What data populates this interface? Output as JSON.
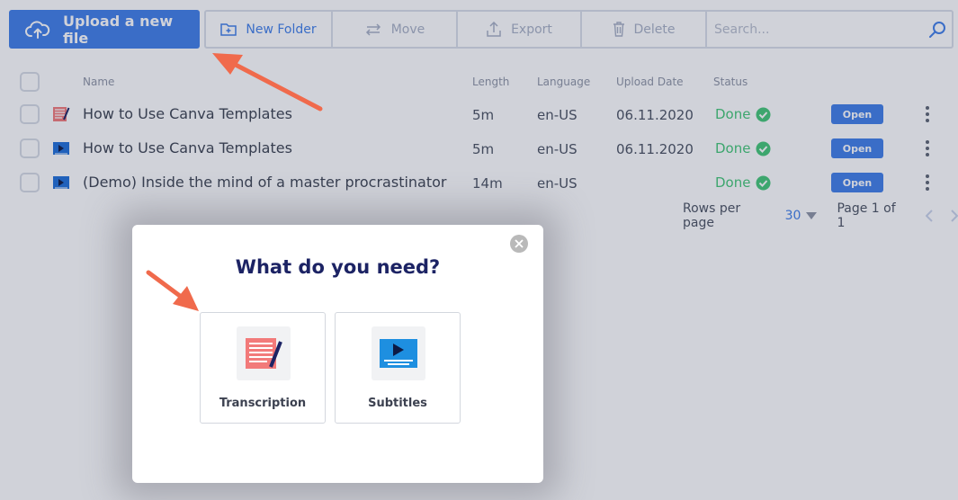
{
  "toolbar": {
    "upload_label": "Upload a new file",
    "new_folder_label": "New Folder",
    "move_label": "Move",
    "export_label": "Export",
    "delete_label": "Delete",
    "search_placeholder": "Search..."
  },
  "table": {
    "headers": {
      "name": "Name",
      "length": "Length",
      "language": "Language",
      "upload_date": "Upload Date",
      "status": "Status"
    },
    "rows": [
      {
        "icon": "transcript-icon",
        "name": "How to Use Canva Templates",
        "length": "5m",
        "language": "en-US",
        "date": "06.11.2020",
        "status": "Done",
        "action": "Open"
      },
      {
        "icon": "video-icon",
        "name": "How to Use Canva Templates",
        "length": "5m",
        "language": "en-US",
        "date": "06.11.2020",
        "status": "Done",
        "action": "Open"
      },
      {
        "icon": "video-icon",
        "name": "(Demo) Inside the mind of a master procrastinator",
        "length": "14m",
        "language": "en-US",
        "date": "",
        "status": "Done",
        "action": "Open"
      }
    ]
  },
  "pagination": {
    "rows_per_page_label": "Rows per page",
    "rows_per_page_value": "30",
    "page_info": "Page 1 of 1"
  },
  "modal": {
    "title": "What do you need?",
    "options": [
      {
        "label": "Transcription",
        "icon": "transcription-icon"
      },
      {
        "label": "Subtitles",
        "icon": "subtitles-icon"
      }
    ]
  },
  "colors": {
    "accent": "#3f7ee8",
    "done": "#43c776",
    "title": "#1c2364",
    "annotation_arrow": "#f06a4c"
  }
}
